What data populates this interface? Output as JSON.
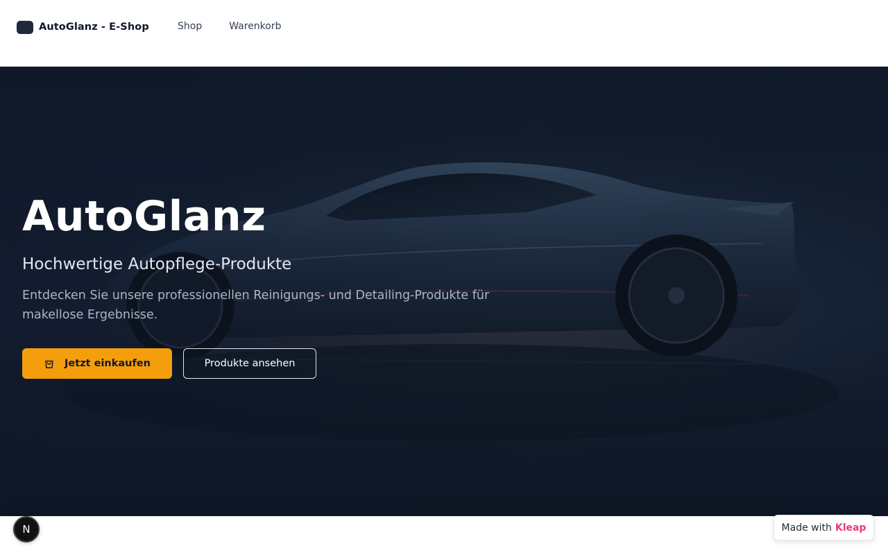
{
  "header": {
    "brand_name": "AutoGlanz - E-Shop",
    "nav": [
      {
        "label": "Shop"
      },
      {
        "label": "Warenkorb"
      }
    ]
  },
  "hero": {
    "title": "AutoGlanz",
    "subtitle": "Hochwertige Autopflege-Produkte",
    "text": "Entdecken Sie unsere professionellen Reinigungs- und Detailing-Produkte für makellose Ergebnisse.",
    "primary_button": {
      "label": "Jetzt einkaufen",
      "icon": "shopping-bag-icon"
    },
    "secondary_button": {
      "label": "Produkte ansehen"
    }
  },
  "widgets": {
    "n_badge": "N",
    "made_with": "Made with",
    "made_with_brand": "Kleap"
  },
  "colors": {
    "accent": "#f59e0b",
    "brand_pink": "#ec3b6e",
    "hero_bg": "#101b29"
  }
}
